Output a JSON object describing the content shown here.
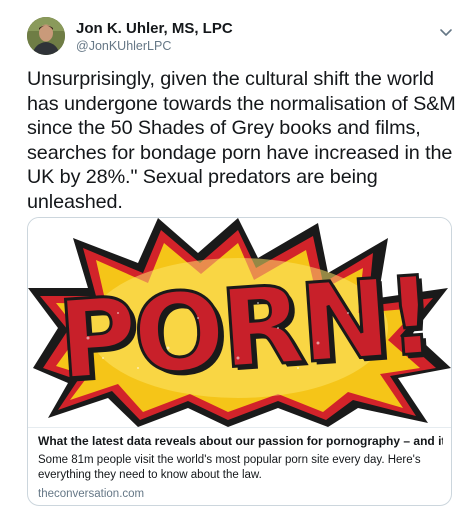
{
  "author": {
    "name": "Jon K. Uhler, MS, LPC",
    "handle": "@JonKUhlerLPC"
  },
  "tweet": {
    "text": "Unsurprisingly, given the cultural shift the world has undergone towards the normalisation of S&M since the 50 Shades of Grey books and films, searches for bondage porn have increased in the UK by 28%.\" Sexual predators are being unleashed."
  },
  "card": {
    "image_text": "PORN!",
    "title": "What the latest data reveals about our passion for pornography – and its lega...",
    "description": "Some 81m people visit the world's most popular porn site every day. Here's everything they need to know about the law.",
    "domain": "theconversation.com"
  },
  "icons": {
    "more": "chevron-down-icon",
    "avatar": "avatar"
  },
  "colors": {
    "text": "#14171a",
    "secondary": "#657786",
    "border": "#ccd6dd",
    "burst_yellow": "#f5c518",
    "burst_red": "#d2232a"
  }
}
